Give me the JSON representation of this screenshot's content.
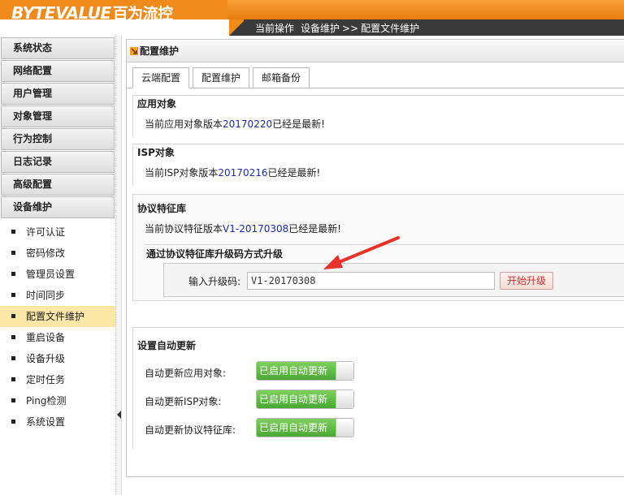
{
  "header": {
    "logo_en": "BYTEVALUE",
    "logo_cn": "百为流控",
    "crumb_label": "当前操作",
    "crumb_section": "设备维护",
    "crumb_sep": ">>",
    "crumb_page": "配置文件维护"
  },
  "sidebar": {
    "menu": [
      {
        "label": "系统状态"
      },
      {
        "label": "网络配置"
      },
      {
        "label": "用户管理"
      },
      {
        "label": "对象管理"
      },
      {
        "label": "行为控制"
      },
      {
        "label": "日志记录"
      },
      {
        "label": "高级配置"
      },
      {
        "label": "设备维护"
      }
    ],
    "submenu": [
      {
        "label": "许可认证"
      },
      {
        "label": "密码修改"
      },
      {
        "label": "管理员设置"
      },
      {
        "label": "时间同步"
      },
      {
        "label": "配置文件维护"
      },
      {
        "label": "重启设备"
      },
      {
        "label": "设备升级"
      },
      {
        "label": "定时任务"
      },
      {
        "label": "Ping检测"
      },
      {
        "label": "系统设置"
      }
    ]
  },
  "main": {
    "title": "配置维护",
    "tabs": [
      {
        "label": "云端配置"
      },
      {
        "label": "配置维护"
      },
      {
        "label": "邮箱备份"
      }
    ],
    "app_object": {
      "title": "应用对象",
      "prefix": "当前应用对象版本",
      "version": "20170220",
      "suffix": "已经是最新!"
    },
    "isp_object": {
      "title": "ISP对象",
      "prefix": "当前ISP对象版本",
      "version": "20170216",
      "suffix": "已经是最新!"
    },
    "protocol": {
      "title": "协议特征库",
      "prefix": "当前协议特征版本",
      "version": "V1-20170308",
      "suffix": "已经是最新!",
      "upgrade_title": "通过协议特征库升级码方式升级",
      "input_label": "输入升级码:",
      "input_value": "V1-20170308",
      "start_button": "开始升级"
    },
    "auto_update": {
      "title": "设置自动更新",
      "rows": [
        {
          "label": "自动更新应用对象:",
          "toggle": "已启用自动更新"
        },
        {
          "label": "自动更新ISP对象:",
          "toggle": "已启用自动更新"
        },
        {
          "label": "自动更新协议特征库:",
          "toggle": "已启用自动更新"
        }
      ]
    }
  },
  "colors": {
    "brand_orange": "#f08a1a",
    "header_dark": "#3a3a3a",
    "version_blue": "#1a2cb0",
    "toggle_green": "#4aa733",
    "active_menu": "#fde7a6",
    "annotation_red": "#e8322a"
  }
}
